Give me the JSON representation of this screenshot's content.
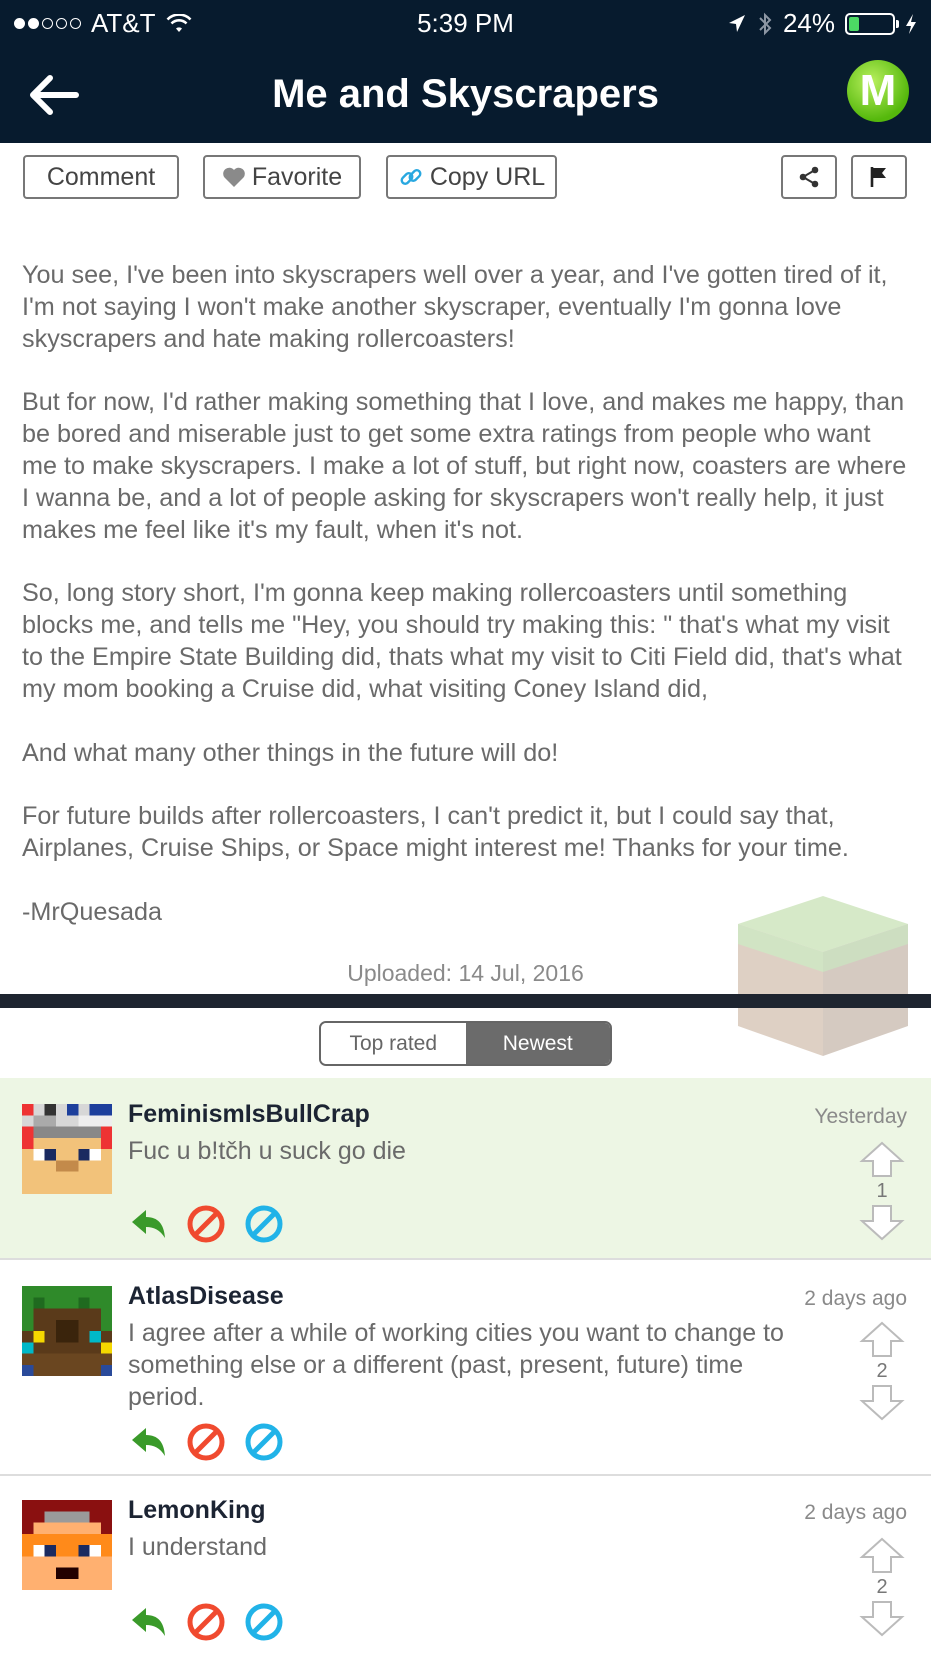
{
  "status": {
    "carrier": "AT&T",
    "time": "5:39 PM",
    "battery": "24%"
  },
  "header": {
    "title": "Me and Skyscrapers",
    "logo_letter": "M"
  },
  "toolbar": {
    "comment": "Comment",
    "favorite": "Favorite",
    "copy_url": "Copy URL"
  },
  "post": {
    "paragraphs": [
      "You see, I've been into skyscrapers well over a year, and I've gotten tired of it, I'm not saying I won't make another skyscraper, eventually I'm gonna love skyscrapers and hate making rollercoasters!",
      "But for now, I'd rather making something that I love, and makes me happy, than be bored and miserable just to get some extra ratings from people who want me to make skyscrapers. I make a lot of stuff, but right now, coasters are where I wanna be, and a lot of people asking for skyscrapers won't really help, it just makes me feel like it's my fault, when it's not.",
      "So, long story short, I'm gonna keep making rollercoasters until something blocks me, and tells me \"Hey, you should try making this:      \" that's what my visit to the Empire State Building did, thats what my visit to Citi Field did, that's what my mom booking a Cruise did, what visiting Coney Island did,",
      "And what many other things in the future will do!",
      "For future builds after rollercoasters, I can't predict it, but I could say that, Airplanes, Cruise Ships, or Space might interest me! Thanks for your time.",
      "-MrQuesada"
    ],
    "uploaded": "Uploaded: 14 Jul, 2016"
  },
  "sort": {
    "top_rated": "Top rated",
    "newest": "Newest",
    "selected": "Newest"
  },
  "comments": [
    {
      "user": "FeminismIsBullCrap",
      "time": "Yesterday",
      "text": "Fuc u b!tčh u suck go die",
      "votes": "1",
      "highlight": "#edf6e4"
    },
    {
      "user": "AtlasDisease",
      "time": "2 days ago",
      "text": "I agree after a while of working cities you want to change to something else or a different (past, present, future) time period.",
      "votes": "2",
      "highlight": "#ffffff"
    },
    {
      "user": "LemonKing",
      "time": "2 days ago",
      "text": "I understand",
      "votes": "2",
      "highlight": "#ffffff"
    }
  ]
}
